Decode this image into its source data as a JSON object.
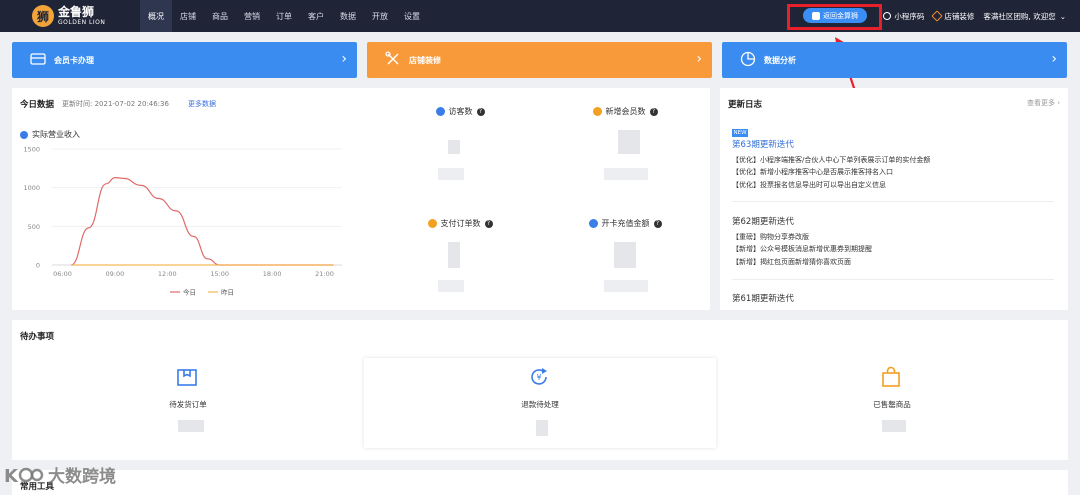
{
  "brand": {
    "name": "金鲁狮",
    "name_en": "GOLDEN LION"
  },
  "nav": {
    "items": [
      {
        "label": "概况",
        "active": true
      },
      {
        "label": "店铺",
        "active": false
      },
      {
        "label": "商品",
        "active": false
      },
      {
        "label": "营销",
        "active": false
      },
      {
        "label": "订单",
        "active": false
      },
      {
        "label": "客户",
        "active": false
      },
      {
        "label": "数据",
        "active": false
      },
      {
        "label": "开放",
        "active": false
      },
      {
        "label": "设置",
        "active": false
      }
    ],
    "enter_button": "返回金算狮",
    "mini_program": "小程序码",
    "shop_decorate": "店铺装修",
    "welcome": "客满社区团购, 欢迎您"
  },
  "quick_cards": [
    {
      "label": "会员卡办理",
      "color": "#3b8cf0"
    },
    {
      "label": "店铺装修",
      "color": "#f99a3a"
    },
    {
      "label": "数据分析",
      "color": "#3b8cf0"
    }
  ],
  "today": {
    "title": "今日数据",
    "updated_label": "更新时间: 2021-07-02 20:46:36",
    "more_data": "更多数据",
    "revenue_title": "实际营业收入",
    "stats": [
      {
        "label": "访客数",
        "icon": "visitor-icon",
        "color": "#3a7de8"
      },
      {
        "label": "新增会员数",
        "icon": "member-icon",
        "color": "#f2a020"
      },
      {
        "label": "支付订单数",
        "icon": "order-icon",
        "color": "#f2a020"
      },
      {
        "label": "开卡充值金额",
        "icon": "card-icon",
        "color": "#3a7de8"
      }
    ]
  },
  "chart_data": {
    "type": "line",
    "x": [
      "06:00",
      "09:00",
      "12:00",
      "15:00",
      "18:00",
      "21:00"
    ],
    "yticks": [
      0,
      500,
      1000,
      1500
    ],
    "ylim": [
      0,
      1500
    ],
    "series": [
      {
        "name": "今日",
        "color": "#e06a6a",
        "points": [
          [
            6.5,
            0
          ],
          [
            7.5,
            480
          ],
          [
            8.5,
            1050
          ],
          [
            9.0,
            1130
          ],
          [
            9.5,
            1120
          ],
          [
            10.5,
            1030
          ],
          [
            11.5,
            860
          ],
          [
            12.5,
            700
          ],
          [
            13.5,
            370
          ],
          [
            14.3,
            80
          ],
          [
            15.0,
            0
          ],
          [
            21.5,
            0
          ]
        ]
      },
      {
        "name": "昨日",
        "color": "#f5b95a",
        "points": [
          [
            6.5,
            0
          ],
          [
            21.5,
            0
          ]
        ]
      }
    ],
    "legend": "bottom-center"
  },
  "update_log": {
    "title": "更新日志",
    "more": "查看更多",
    "badge": "NEW",
    "entries": [
      {
        "title": "第63期更新迭代",
        "highlight": true,
        "items": [
          "【优化】小程序端推客/合伙人中心下单列表展示订单的实付金额",
          "【优化】新增小程序推客中心是否展示推客排名入口",
          "【优化】投票报名信息导出时可以导出自定义信息"
        ]
      },
      {
        "title": "第62期更新迭代",
        "highlight": false,
        "items": [
          "【重磅】购物分享券改版",
          "【新增】公众号模板消息新增优惠券到期提醒",
          "【新增】揭红包页面新增猜你喜欢页面"
        ]
      },
      {
        "title": "第61期更新迭代",
        "highlight": false,
        "items": []
      }
    ]
  },
  "todo": {
    "title": "待办事项",
    "items": [
      {
        "label": "待发货订单",
        "icon": "box-icon"
      },
      {
        "label": "退款待处理",
        "icon": "refund-icon"
      },
      {
        "label": "已售罄商品",
        "icon": "bag-icon"
      }
    ]
  },
  "tools": {
    "title": "常用工具"
  },
  "watermark": {
    "text": "大数跨境"
  }
}
